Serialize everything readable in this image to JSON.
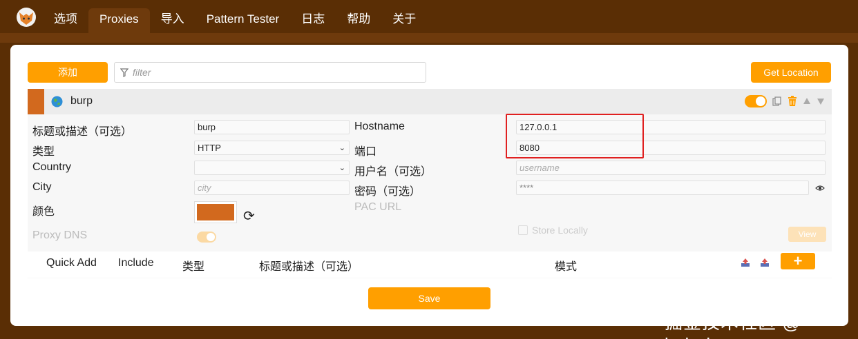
{
  "nav": {
    "tabs": [
      {
        "label": "选项"
      },
      {
        "label": "Proxies"
      },
      {
        "label": "导入"
      },
      {
        "label": "Pattern Tester"
      },
      {
        "label": "日志"
      },
      {
        "label": "帮助"
      },
      {
        "label": "关于"
      }
    ],
    "active_tab": "Proxies"
  },
  "toolbar": {
    "add_label": "添加",
    "filter_placeholder": "filter",
    "get_location_label": "Get Location"
  },
  "proxy": {
    "title": "burp",
    "color": "#d2691e",
    "enabled": true,
    "fields": {
      "title_label": "标题或描述（可选）",
      "title_value": "burp",
      "type_label": "类型",
      "type_value": "HTTP",
      "country_label": "Country",
      "country_value": "",
      "city_label": "City",
      "city_placeholder": "city",
      "color_label": "颜色",
      "proxy_dns_label": "Proxy DNS",
      "hostname_label": "Hostname",
      "hostname_value": "127.0.0.1",
      "port_label": "端口",
      "port_value": "8080",
      "username_label": "用户名（可选）",
      "username_placeholder": "username",
      "password_label": "密码（可选）",
      "password_value": "****",
      "pac_url_label": "PAC URL",
      "store_locally_label": "Store Locally",
      "view_label": "View"
    }
  },
  "pattern_table": {
    "headers": [
      "Quick Add",
      "Include",
      "类型",
      "标题或描述（可选）",
      "模式"
    ]
  },
  "save_label": "Save",
  "watermark": "掘金技术社区 @ bcbnb",
  "colors": {
    "accent": "#ff9f00",
    "background": "#5a2e05",
    "highlight": "#e02020"
  }
}
